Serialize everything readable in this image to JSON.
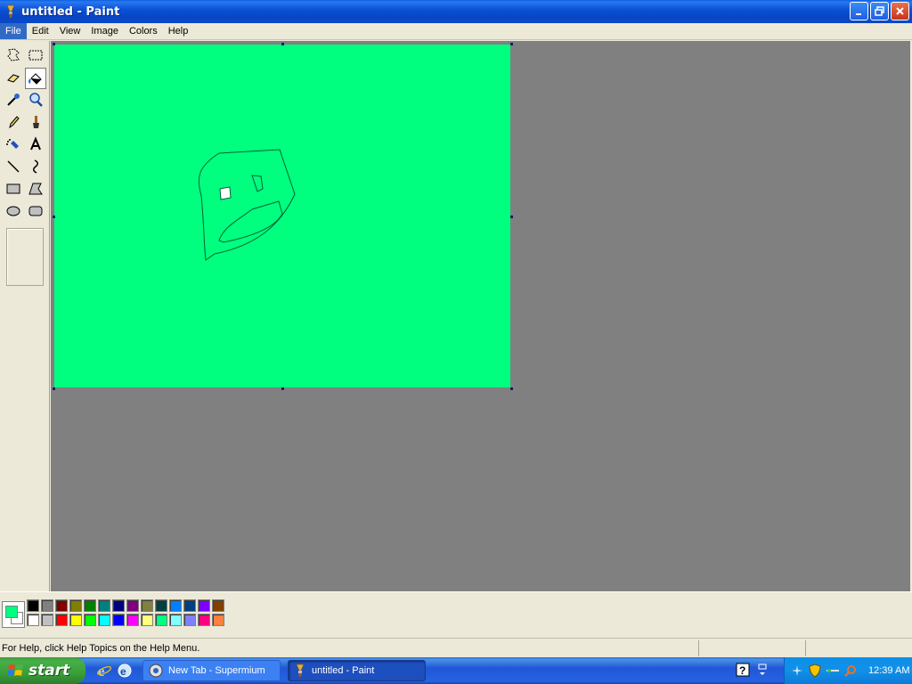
{
  "window": {
    "title": "untitled - Paint"
  },
  "menu": [
    "File",
    "Edit",
    "View",
    "Image",
    "Colors",
    "Help"
  ],
  "tools": [
    {
      "name": "free-form-select-icon"
    },
    {
      "name": "select-icon"
    },
    {
      "name": "eraser-icon"
    },
    {
      "name": "fill-bucket-icon",
      "selected": true
    },
    {
      "name": "pick-color-icon"
    },
    {
      "name": "magnifier-icon"
    },
    {
      "name": "pencil-icon"
    },
    {
      "name": "brush-icon"
    },
    {
      "name": "airbrush-icon"
    },
    {
      "name": "text-icon"
    },
    {
      "name": "line-icon"
    },
    {
      "name": "curve-icon"
    },
    {
      "name": "rectangle-icon"
    },
    {
      "name": "polygon-icon"
    },
    {
      "name": "ellipse-icon"
    },
    {
      "name": "rounded-rectangle-icon"
    }
  ],
  "colors": {
    "foreground": "#00FF7F",
    "background": "#FFFFFF",
    "canvas": "#00FF7F",
    "palette_top": [
      "#000000",
      "#808080",
      "#800000",
      "#808000",
      "#008000",
      "#008080",
      "#000080",
      "#800080",
      "#808040",
      "#004040",
      "#0080FF",
      "#004080",
      "#8000FF",
      "#804000"
    ],
    "palette_bottom": [
      "#FFFFFF",
      "#C0C0C0",
      "#FF0000",
      "#FFFF00",
      "#00FF00",
      "#00FFFF",
      "#0000FF",
      "#FF00FF",
      "#FFFF80",
      "#00FF80",
      "#80FFFF",
      "#8080FF",
      "#FF0080",
      "#FF8040"
    ]
  },
  "status": {
    "help_text": "For Help, click Help Topics on the Help Menu."
  },
  "taskbar": {
    "start_label": "start",
    "tasks": [
      {
        "label": "New Tab - Supermium",
        "icon": "browser-icon"
      },
      {
        "label": "untitled - Paint",
        "icon": "paint-icon",
        "active": true
      }
    ],
    "clock": "12:39 AM"
  }
}
